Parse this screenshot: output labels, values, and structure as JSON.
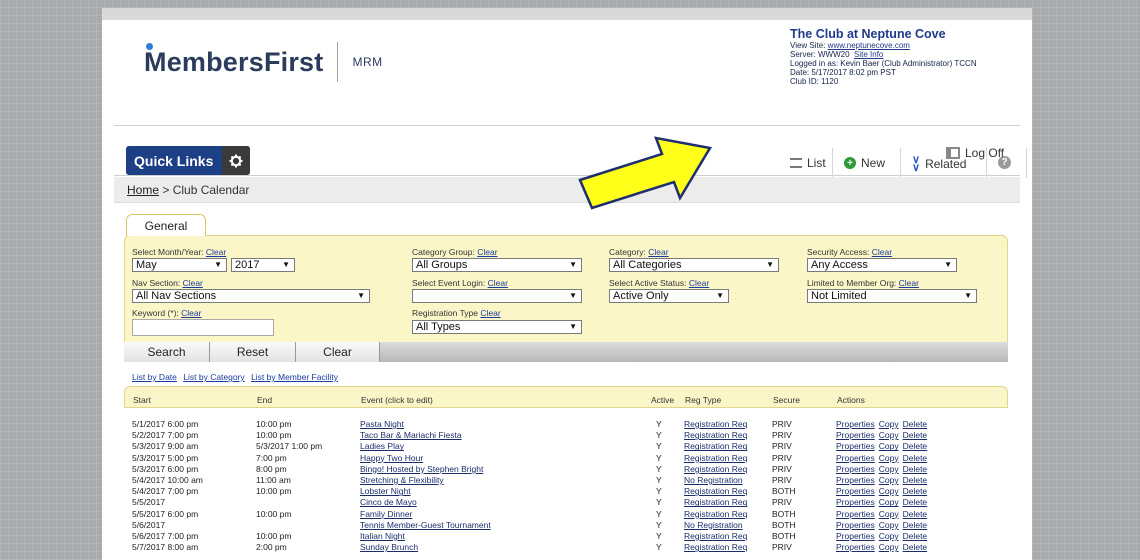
{
  "brand": {
    "logo_a": "Members",
    "logo_b": "First",
    "product": "MRM"
  },
  "club": {
    "name": "The Club at Neptune Cove",
    "view_site_label": "View Site:",
    "view_site_url": "www.neptunecove.com",
    "server": "Server: WWW20",
    "site_info": "Site Info",
    "logged_in": "Logged in as: Kevin Baer (Club Administrator) TCCN",
    "date": "Date: 5/17/2017 8:02 pm PST",
    "club_id": "Club ID: 1120"
  },
  "toolbar": {
    "quick_links": "Quick Links",
    "list": "List",
    "new": "New",
    "related": "Related",
    "log_off": "Log Off"
  },
  "breadcrumb": {
    "home": "Home",
    "sep": " > ",
    "current": "Club Calendar"
  },
  "tab": "General",
  "filters": {
    "clear": "Clear",
    "month_year_label": "Select Month/Year:",
    "month": "May",
    "year": "2017",
    "nav_section_label": "Nav Section:",
    "nav_section": "All Nav Sections",
    "keyword_label": "Keyword (*):",
    "category_group_label": "Category Group:",
    "category_group": "All Groups",
    "event_login_label": "Select Event Login:",
    "event_login": "",
    "reg_type_label": "Registration Type",
    "reg_type": "All Types",
    "category_label": "Category:",
    "category": "All Categories",
    "active_status_label": "Select Active Status:",
    "active_status": "Active Only",
    "security_label": "Security Access:",
    "security": "Any Access",
    "member_org_label": "Limited to Member Org:",
    "member_org": "Not Limited"
  },
  "actions": {
    "search": "Search",
    "reset": "Reset",
    "clear": "Clear"
  },
  "list_links": [
    "List by Date",
    "List by Category",
    "List by Member Facility"
  ],
  "table": {
    "headers": [
      "Start",
      "End",
      "Event (click to edit)",
      "Active",
      "Reg Type",
      "Secure",
      "Actions"
    ],
    "action_labels": [
      "Properties",
      "Copy",
      "Delete"
    ],
    "rows": [
      {
        "start": "5/1/2017 6:00 pm",
        "end": "10:00 pm",
        "event": "Pasta Night",
        "active": "Y",
        "reg": "Registration Req",
        "secure": "PRIV"
      },
      {
        "start": "5/2/2017 7:00 pm",
        "end": "10:00 pm",
        "event": "Taco Bar & Mariachi Fiesta",
        "active": "Y",
        "reg": "Registration Req",
        "secure": "PRIV"
      },
      {
        "start": "5/3/2017 9:00 am",
        "end": "5/3/2017 1:00 pm",
        "event": "Ladies Play",
        "active": "Y",
        "reg": "Registration Req",
        "secure": "PRIV"
      },
      {
        "start": "5/3/2017 5:00 pm",
        "end": "7:00 pm",
        "event": "Happy Two Hour",
        "active": "Y",
        "reg": "Registration Req",
        "secure": "PRIV"
      },
      {
        "start": "5/3/2017 6:00 pm",
        "end": "8:00 pm",
        "event": "Bingo! Hosted by Stephen Bright",
        "active": "Y",
        "reg": "Registration Req",
        "secure": "PRIV"
      },
      {
        "start": "5/4/2017 10:00 am",
        "end": "11:00 am",
        "event": "Stretching & Flexibility",
        "active": "Y",
        "reg": "No Registration",
        "secure": "PRIV"
      },
      {
        "start": "5/4/2017 7:00 pm",
        "end": "10:00 pm",
        "event": "Lobster Night",
        "active": "Y",
        "reg": "Registration Req",
        "secure": "BOTH"
      },
      {
        "start": "5/5/2017",
        "end": "",
        "event": "Cinco de Mayo",
        "active": "Y",
        "reg": "Registration Req",
        "secure": "PRIV"
      },
      {
        "start": "5/5/2017 6:00 pm",
        "end": "10:00 pm",
        "event": "Family Dinner",
        "active": "Y",
        "reg": "Registration Req",
        "secure": "BOTH"
      },
      {
        "start": "5/6/2017",
        "end": "",
        "event": "Tennis Member-Guest Tournament",
        "active": "Y",
        "reg": "No Registration",
        "secure": "BOTH"
      },
      {
        "start": "5/6/2017 7:00 pm",
        "end": "10:00 pm",
        "event": "Italian Night",
        "active": "Y",
        "reg": "Registration Req",
        "secure": "BOTH"
      },
      {
        "start": "5/7/2017 8:00 am",
        "end": "2:00 pm",
        "event": "Sunday Brunch",
        "active": "Y",
        "reg": "Registration Req",
        "secure": "PRIV"
      }
    ]
  },
  "colors": {
    "arrow_fill": "#ffff1a",
    "quick_links_bg": "#1d3f86",
    "filter_bg": "#fbf6c8"
  }
}
